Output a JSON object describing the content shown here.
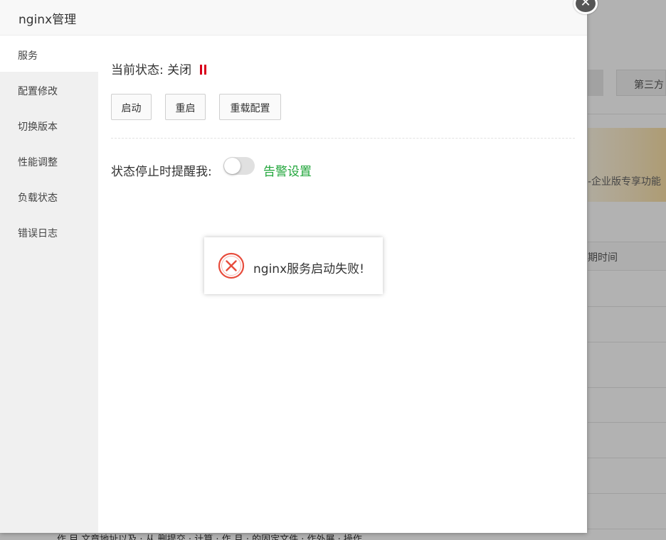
{
  "background": {
    "tab_label": "第三方",
    "banner_text": "-企业版专享功能",
    "table_header": "期时间",
    "bottom_text": "作 目 文章地址以及 · 从 删提交 · 计算 · 作 月 · 的固定文件 · 作外展 · 操作"
  },
  "window": {
    "title": "nginx管理",
    "close_symbol": "✕",
    "sidebar": {
      "items": [
        {
          "label": "服务"
        },
        {
          "label": "配置修改"
        },
        {
          "label": "切换版本"
        },
        {
          "label": "性能调整"
        },
        {
          "label": "负载状态"
        },
        {
          "label": "错误日志"
        }
      ]
    },
    "service": {
      "status_label": "当前状态:",
      "status_value": "关闭",
      "status_icon": "pause-icon",
      "status_color": "#d9001b",
      "buttons": {
        "start": "启动",
        "restart": "重启",
        "reload": "重载配置"
      },
      "remind_label": "状态停止时提醒我:",
      "remind_enabled": false,
      "alarm_link": "告警设置",
      "accent_color": "#20a53a"
    }
  },
  "toast": {
    "icon": "error-circle-icon",
    "message": "nginx服务启动失败!",
    "icon_color": "#e74c3c"
  }
}
